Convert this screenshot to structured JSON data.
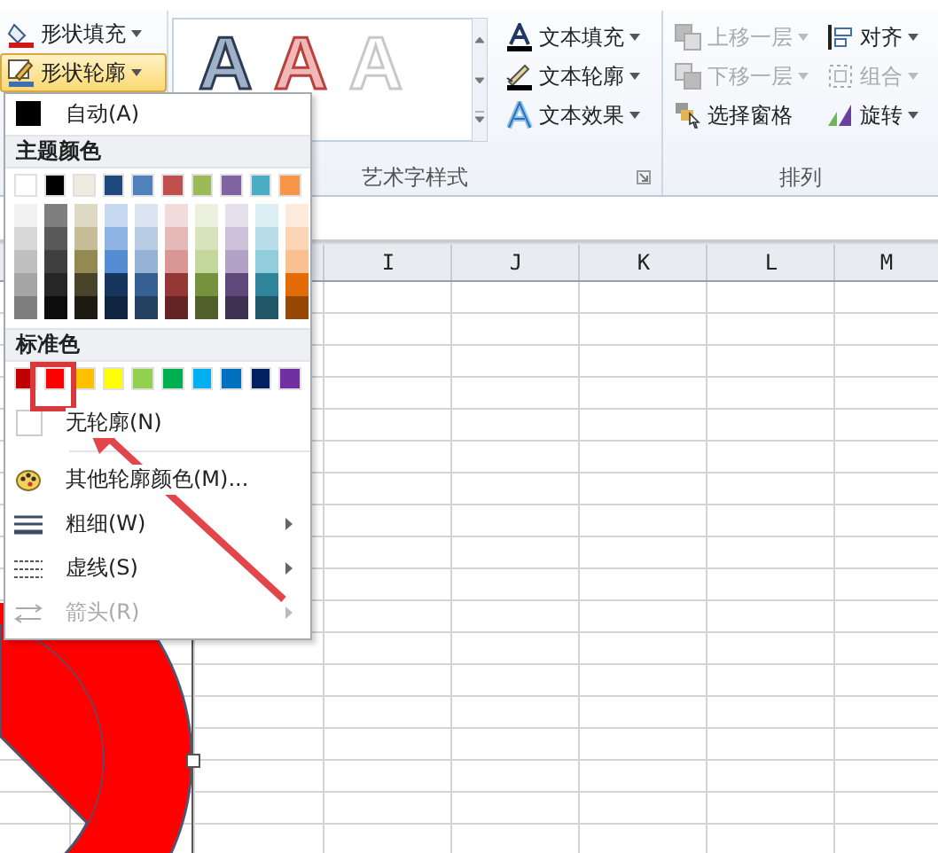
{
  "ribbon": {
    "shape_buttons": [
      {
        "kind": "fill",
        "label": "形状填充",
        "selected": false
      },
      {
        "kind": "outline",
        "label": "形状轮廓",
        "selected": true
      }
    ],
    "wordart_styles": [
      {
        "kind": "dark",
        "letter": "A"
      },
      {
        "kind": "red",
        "letter": "A"
      },
      {
        "kind": "light",
        "letter": "A"
      }
    ],
    "text_buttons": [
      {
        "kind": "text-fill",
        "label": "文本填充"
      },
      {
        "kind": "text-outline",
        "label": "文本轮廓"
      },
      {
        "kind": "text-effect",
        "label": "文本效果"
      }
    ],
    "wordart_group_label": "艺术字样式",
    "arrange_columns": [
      [
        {
          "kind": "forward",
          "label": "上移一层",
          "disabled": true,
          "dropdown": true
        },
        {
          "kind": "backward",
          "label": "下移一层",
          "disabled": true,
          "dropdown": true
        },
        {
          "kind": "pane",
          "label": "选择窗格",
          "disabled": false,
          "dropdown": false
        }
      ],
      [
        {
          "kind": "align",
          "label": "对齐",
          "disabled": false,
          "dropdown": true
        },
        {
          "kind": "group",
          "label": "组合",
          "disabled": true,
          "dropdown": true
        },
        {
          "kind": "rotate",
          "label": "旋转",
          "disabled": false,
          "dropdown": true
        }
      ]
    ],
    "arrange_group_label": "排列"
  },
  "sheet": {
    "columns": [
      "I",
      "J",
      "K",
      "L",
      "M"
    ]
  },
  "menu": {
    "auto": {
      "label": "自动(A)",
      "color": "#000000"
    },
    "theme_heading": "主题颜色",
    "theme_colors": [
      {
        "color": "#ffffff",
        "shades": [
          {
            "color": "#f2f2f2"
          },
          {
            "color": "#d8d8d8"
          },
          {
            "color": "#bfbfbf"
          },
          {
            "color": "#a5a5a5"
          },
          {
            "color": "#7f7f7f"
          }
        ]
      },
      {
        "color": "#000000",
        "shades": [
          {
            "color": "#7f7f7f"
          },
          {
            "color": "#595959"
          },
          {
            "color": "#3f3f3f"
          },
          {
            "color": "#262626"
          },
          {
            "color": "#0c0c0c"
          }
        ]
      },
      {
        "color": "#eeece1",
        "shades": [
          {
            "color": "#ddd9c3"
          },
          {
            "color": "#c4bd97"
          },
          {
            "color": "#938953"
          },
          {
            "color": "#494429"
          },
          {
            "color": "#1d1b10"
          }
        ]
      },
      {
        "color": "#1f497d",
        "shades": [
          {
            "color": "#c6d9f0"
          },
          {
            "color": "#8db3e2"
          },
          {
            "color": "#548dd4"
          },
          {
            "color": "#17365d"
          },
          {
            "color": "#0f243e"
          }
        ]
      },
      {
        "color": "#4f81bd",
        "shades": [
          {
            "color": "#dbe5f1"
          },
          {
            "color": "#b8cce4"
          },
          {
            "color": "#95b3d7"
          },
          {
            "color": "#366092"
          },
          {
            "color": "#244061"
          }
        ]
      },
      {
        "color": "#c0504d",
        "shades": [
          {
            "color": "#f2dcdb"
          },
          {
            "color": "#e5b9b7"
          },
          {
            "color": "#d99694"
          },
          {
            "color": "#953734"
          },
          {
            "color": "#632423"
          }
        ]
      },
      {
        "color": "#9bbb59",
        "shades": [
          {
            "color": "#ebf1dd"
          },
          {
            "color": "#d7e3bc"
          },
          {
            "color": "#c3d69b"
          },
          {
            "color": "#76923c"
          },
          {
            "color": "#4f6128"
          }
        ]
      },
      {
        "color": "#8064a2",
        "shades": [
          {
            "color": "#e5e0ec"
          },
          {
            "color": "#ccc1d9"
          },
          {
            "color": "#b2a2c7"
          },
          {
            "color": "#5f497a"
          },
          {
            "color": "#3f3151"
          }
        ]
      },
      {
        "color": "#4bacc6",
        "shades": [
          {
            "color": "#dbeef3"
          },
          {
            "color": "#b7dde8"
          },
          {
            "color": "#92cddc"
          },
          {
            "color": "#31859b"
          },
          {
            "color": "#205867"
          }
        ]
      },
      {
        "color": "#f79646",
        "shades": [
          {
            "color": "#fdeada"
          },
          {
            "color": "#fbd5b5"
          },
          {
            "color": "#fac08f"
          },
          {
            "color": "#e36c09"
          },
          {
            "color": "#974806"
          }
        ]
      }
    ],
    "standard_heading": "标准色",
    "standard_colors": [
      {
        "color": "#c00000"
      },
      {
        "color": "#ff0000"
      },
      {
        "color": "#ffc000"
      },
      {
        "color": "#ffff00"
      },
      {
        "color": "#92d050"
      },
      {
        "color": "#00b050"
      },
      {
        "color": "#00b0f0"
      },
      {
        "color": "#0070c0"
      },
      {
        "color": "#002060"
      },
      {
        "color": "#7030a0"
      }
    ],
    "items": [
      {
        "kind": "none",
        "label": "无轮廓(N)",
        "disabled": false,
        "submenu": false
      },
      {
        "kind": "more",
        "label": "其他轮廓颜色(M)...",
        "disabled": false,
        "submenu": false
      },
      {
        "kind": "weight",
        "label": "粗细(W)",
        "disabled": false,
        "submenu": true
      },
      {
        "kind": "dash",
        "label": "虚线(S)",
        "disabled": false,
        "submenu": true
      },
      {
        "kind": "arrows",
        "label": "箭头(R)",
        "disabled": true,
        "submenu": true
      }
    ]
  }
}
